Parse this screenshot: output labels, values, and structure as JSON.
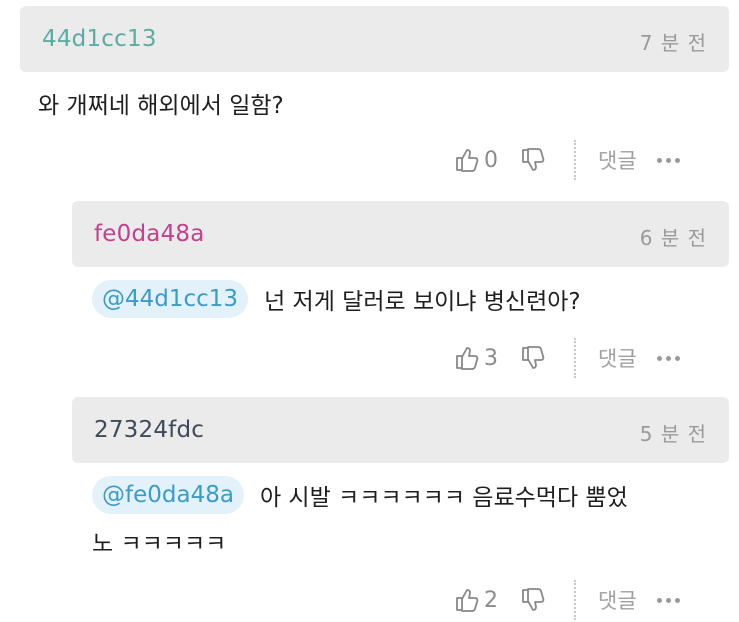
{
  "colors": {
    "author_1": "#5aaca3",
    "author_2": "#c2408e",
    "author_3": "#3e4a5c",
    "mention_bg": "#e3f2fa",
    "mention_text": "#3a9bc8",
    "header_bg": "#ebebeb"
  },
  "comments": [
    {
      "author": "44d1cc13",
      "time": "7 분 전",
      "text": "와 개쩌네 해외에서 일함?",
      "likes": "0",
      "reply_label": "댓글"
    },
    {
      "author": "fe0da48a",
      "time": "6 분 전",
      "mention": "@44d1cc13",
      "text": "넌 저게 달러로 보이냐 병신련아?",
      "likes": "3",
      "reply_label": "댓글"
    },
    {
      "author": "27324fdc",
      "time": "5 분 전",
      "mention": "@fe0da48a",
      "text_line1": "아 시발 ㅋㅋㅋㅋㅋㅋ 음료수먹다 뿜었",
      "text_line2": "노 ㅋㅋㅋㅋㅋ",
      "likes": "2",
      "reply_label": "댓글"
    }
  ]
}
